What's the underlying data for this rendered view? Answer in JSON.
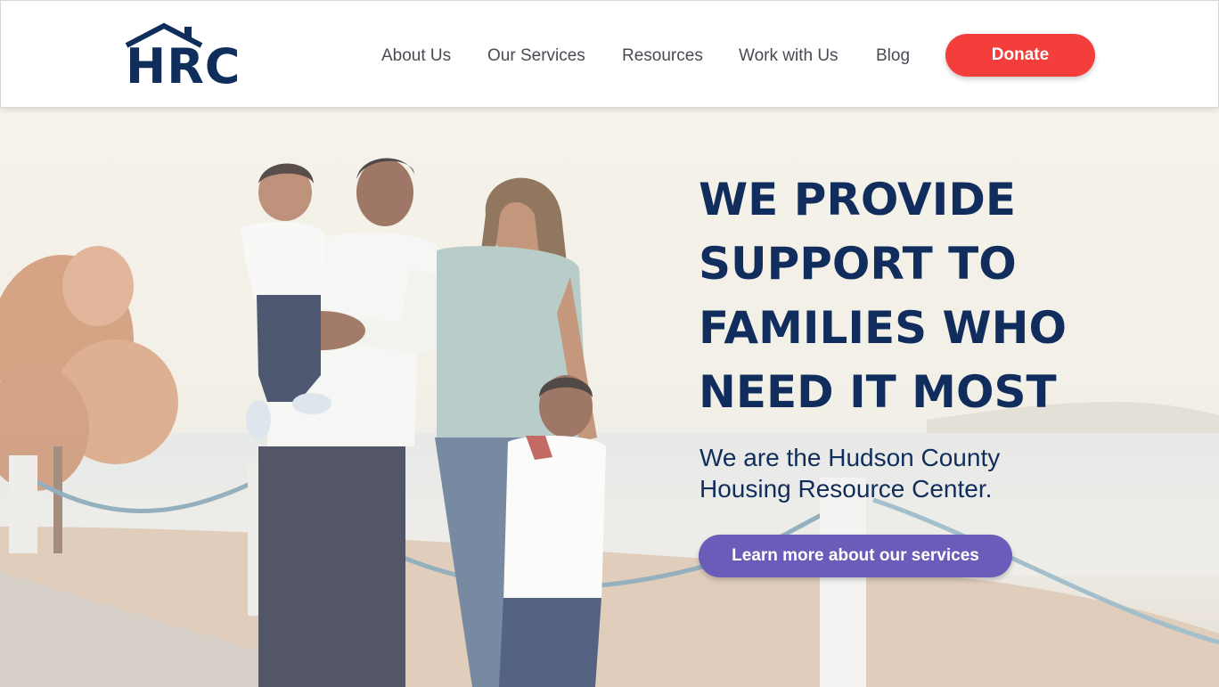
{
  "brand": {
    "logo_text": "HRC",
    "navy": "#0f2e5c"
  },
  "nav": {
    "items": [
      {
        "label": "About Us"
      },
      {
        "label": "Our Services"
      },
      {
        "label": "Resources"
      },
      {
        "label": "Work with Us"
      },
      {
        "label": "Blog"
      }
    ],
    "donate_label": "Donate",
    "donate_color": "#f33e3c"
  },
  "hero": {
    "headline_lines": [
      "WE PROVIDE",
      "SUPPORT TO",
      "FAMILIES WHO",
      "NEED IT MOST"
    ],
    "subhead_lines": [
      "We are the Hudson County",
      "Housing Resource Center."
    ],
    "cta_label": "Learn more about our services",
    "cta_color": "#6a5cb8",
    "photo_icon": "family-photo"
  }
}
